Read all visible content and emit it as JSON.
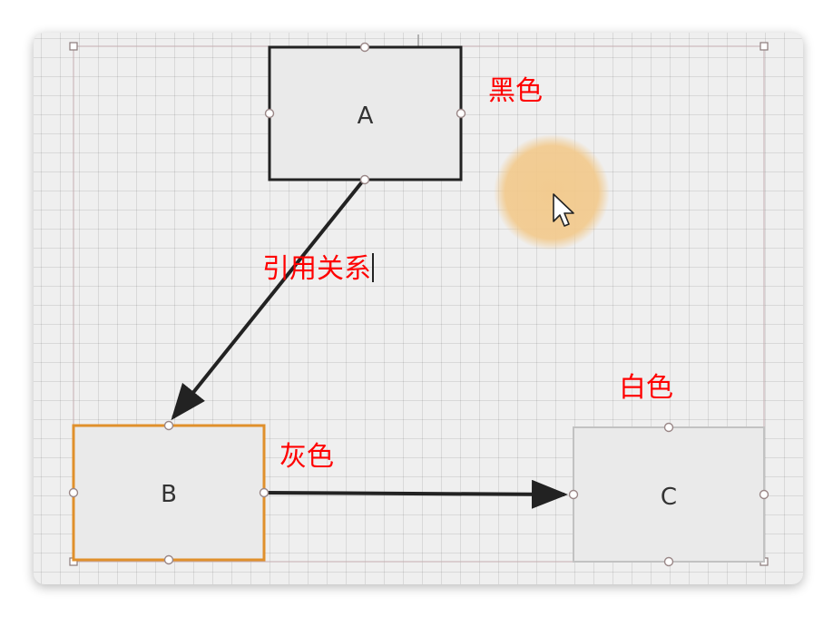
{
  "nodes": {
    "a": {
      "label": "A",
      "color_note": "黑色"
    },
    "b": {
      "label": "B",
      "color_note": "灰色"
    },
    "c": {
      "label": "C",
      "color_note": "白色"
    }
  },
  "edge_label": "引用关系",
  "colors": {
    "node_a_border": "#222222",
    "node_b_border": "#e0902c",
    "node_c_border": "#c2c2c2",
    "annotation": "#ff0000",
    "edge": "#222222",
    "cursor_halo": "#f2c98b"
  },
  "icons": [
    "mouse-cursor-icon"
  ]
}
